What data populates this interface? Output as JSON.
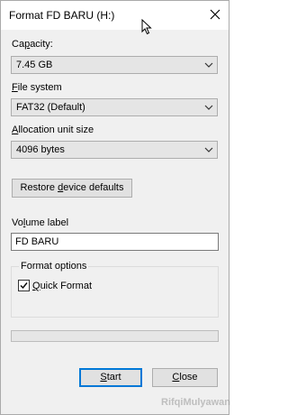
{
  "window": {
    "title": "Format FD BARU (H:)"
  },
  "capacity": {
    "label": "Capacity:",
    "value": "7.45 GB"
  },
  "file_system": {
    "label": "File system",
    "value": "FAT32 (Default)"
  },
  "allocation": {
    "label": "Allocation unit size",
    "value": "4096 bytes"
  },
  "restore_button": "Restore device defaults",
  "volume": {
    "label": "Volume label",
    "value": "FD BARU"
  },
  "format_options": {
    "label": "Format options",
    "quick_format_label": "Quick Format",
    "quick_format_checked": true
  },
  "progress": {
    "value": 0
  },
  "buttons": {
    "start": "Start",
    "close": "Close"
  },
  "watermark": "RifqiMulyawan",
  "colors": {
    "accent": "#0078d7",
    "progress_fill": "#06b025"
  }
}
